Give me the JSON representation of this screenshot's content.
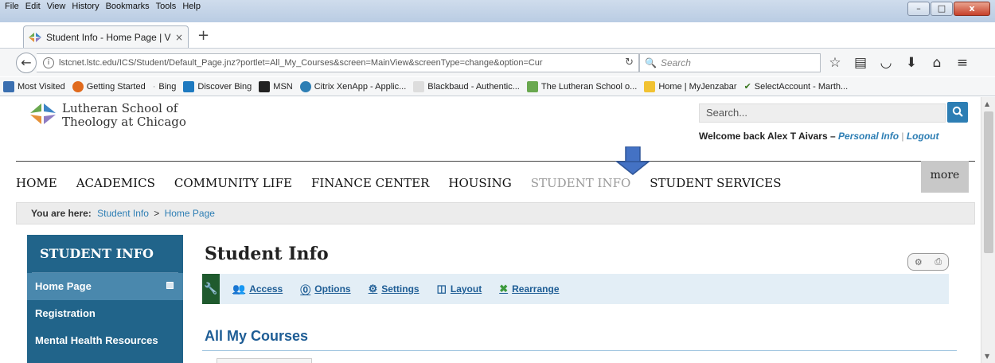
{
  "menubar": [
    "File",
    "Edit",
    "View",
    "History",
    "Bookmarks",
    "Tools",
    "Help"
  ],
  "window_controls": {
    "minimize": "–",
    "maximize": "□",
    "close": "x"
  },
  "tab": {
    "title": "Student Info - Home Page | V",
    "close": "×",
    "new_tab": "+"
  },
  "address_bar": {
    "url": "lstcnet.lstc.edu/ICS/Student/Default_Page.jnz?portlet=All_My_Courses&screen=MainView&screenType=change&option=Cur",
    "info_icon": "i",
    "reload_icon": "C",
    "search_placeholder": "Search"
  },
  "toolbar_icons": [
    "star-icon",
    "library-icon",
    "pocket-icon",
    "download-icon",
    "home-icon",
    "menu-icon"
  ],
  "bookmarks": [
    {
      "label": "Most Visited",
      "icon_color": "#3a6fb0"
    },
    {
      "label": "Getting Started",
      "icon_color": "#e06a1d"
    },
    {
      "label": "Bing",
      "icon_color": "#ffffff"
    },
    {
      "label": "Discover Bing",
      "icon_color": "#1e7ac0"
    },
    {
      "label": "MSN",
      "icon_color": "#222222"
    },
    {
      "label": "Citrix XenApp - Applic...",
      "icon_color": "#2d7eb4"
    },
    {
      "label": "Blackbaud - Authentic...",
      "icon_color": "#dddddd"
    },
    {
      "label": "The Lutheran School o...",
      "icon_color": "#6aa84f"
    },
    {
      "label": "Home | MyJenzabar",
      "icon_color": "#f1c232"
    },
    {
      "label": "SelectAccount - Marth...",
      "icon_color": "#38761d"
    }
  ],
  "site": {
    "logo_line1": "Lutheran School of",
    "logo_line2": "Theology at Chicago",
    "search_placeholder": "Search...",
    "welcome_text": "Welcome back Alex T Aivars",
    "welcome_dash": "–",
    "personal_info": "Personal Info",
    "logout": "Logout",
    "nav": [
      "HOME",
      "ACADEMICS",
      "COMMUNITY LIFE",
      "FINANCE CENTER",
      "HOUSING",
      "STUDENT INFO",
      "STUDENT SERVICES"
    ],
    "nav_active_index": 5,
    "more": "more",
    "breadcrumb": {
      "label": "You are here:",
      "items": [
        "Student Info",
        "Home Page"
      ],
      "sep": ">"
    }
  },
  "sidebar": {
    "title": "STUDENT INFO",
    "items": [
      "Home Page",
      "Registration",
      "Mental Health Resources"
    ]
  },
  "main": {
    "title": "Student Info",
    "toolbar": [
      "Access",
      "Options",
      "Settings",
      "Layout",
      "Rearrange"
    ],
    "section_title": "All My Courses"
  },
  "colors": {
    "sidebar_bg": "#21648a",
    "accent_link": "#2d7eb4",
    "toolbar_bg": "#e3eef6",
    "arrow": "#2f5597"
  }
}
